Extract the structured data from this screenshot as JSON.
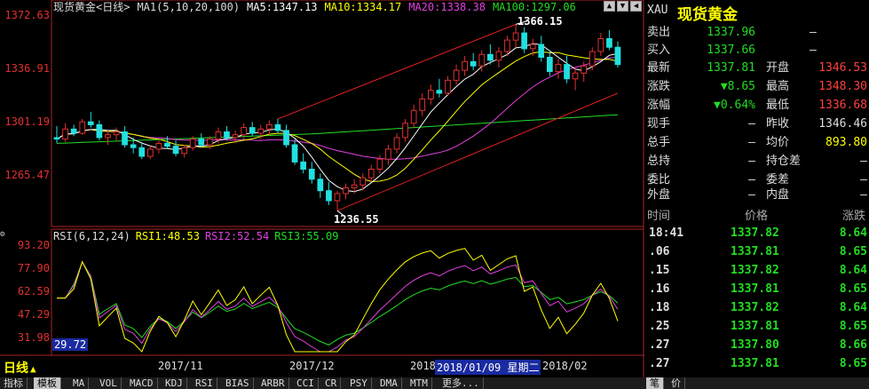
{
  "legend": {
    "symbol": "现货黄金<日线>",
    "ma_label": "MA1(5,10,20,100)",
    "ma5": "MA5:1347.13",
    "ma10": "MA10:1334.17",
    "ma20": "MA20:1338.38",
    "ma100": "MA100:1297.06"
  },
  "rsi_legend": {
    "label": "RSI(6,12,24)",
    "rsi1": "RSI1:48.53",
    "rsi2": "RSI2:52.54",
    "rsi3": "RSI3:55.09"
  },
  "price_axis": [
    "1372.63",
    "1336.91",
    "1301.19",
    "1265.47"
  ],
  "rsi_axis": [
    "93.20",
    "77.90",
    "62.59",
    "47.29",
    "31.98"
  ],
  "rsi_cursor_value": "29.72",
  "annotations": {
    "high": "1366.15",
    "low": "1236.55"
  },
  "x_axis": {
    "m1": "2017/11",
    "m2": "2017/12",
    "m3": "2018",
    "cursor_date": "2018/01/09 星期二",
    "m4": "2018/02"
  },
  "period_label": "日线",
  "period_arrow": "▲",
  "window_buttons": [
    "▲",
    "▼",
    "◀"
  ],
  "panel": {
    "code": "XAU",
    "name": "现货黄金",
    "sell_label": "卖出",
    "sell_value": "1337.96",
    "sell_extra": "–",
    "buy_label": "买入",
    "buy_value": "1337.66",
    "buy_extra": "–",
    "rows": [
      {
        "l1": "最新",
        "v1": "1337.81",
        "l2": "开盘",
        "v2": "1346.53"
      },
      {
        "l1": "涨跌",
        "v1": "▼8.65",
        "l2": "最高",
        "v2": "1348.30"
      },
      {
        "l1": "涨幅",
        "v1": "▼0.64%",
        "l2": "最低",
        "v2": "1336.68"
      },
      {
        "l1": "现手",
        "v1": "–",
        "l2": "昨收",
        "v2": "1346.46"
      },
      {
        "l1": "总手",
        "v1": "–",
        "l2": "均价",
        "v2": "893.80"
      },
      {
        "l1": "总持",
        "v1": "–",
        "l2": "持仓差",
        "v2": "–"
      },
      {
        "l1": "委比",
        "v1": "–",
        "l2": "委差",
        "v2": "–"
      },
      {
        "l1": "外盘",
        "v1": "–",
        "l2": "内盘",
        "v2": "–"
      }
    ],
    "tick_headers": {
      "time": "时间",
      "price": "价格",
      "change": "涨跌"
    },
    "ticks": [
      {
        "t": "18:41",
        "p": "1337.82",
        "c": "8.64"
      },
      {
        "t": ".06",
        "p": "1337.81",
        "c": "8.65"
      },
      {
        "t": ".15",
        "p": "1337.82",
        "c": "8.64"
      },
      {
        "t": ".16",
        "p": "1337.81",
        "c": "8.65"
      },
      {
        "t": ".18",
        "p": "1337.82",
        "c": "8.64"
      },
      {
        "t": ".25",
        "p": "1337.81",
        "c": "8.65"
      },
      {
        "t": ".27",
        "p": "1337.80",
        "c": "8.66"
      },
      {
        "t": ".27",
        "p": "1337.81",
        "c": "8.65"
      }
    ],
    "footer_tabs": [
      "笔",
      "价"
    ]
  },
  "bottom_tabs": [
    "指标",
    "模板",
    "MA",
    "VOL",
    "MACD",
    "KDJ",
    "RSI",
    "BIAS",
    "ARBR",
    "CCI",
    "CR",
    "PSY",
    "DMA",
    "MTM",
    "更多..."
  ],
  "colors": {
    "up": "#e03030",
    "down": "#22e0e0",
    "ma5": "#ffffff",
    "ma10": "#ffff00",
    "ma20": "#e040e0",
    "ma100": "#22dd22",
    "green_val": "#22dd22",
    "red_val": "#ff4040"
  },
  "chart_data": {
    "type": "candlestick",
    "y_range_price": [
      1230,
      1378
    ],
    "y_range_rsi": [
      25,
      98
    ],
    "candles": [
      [
        1287,
        1295,
        1283,
        1286
      ],
      [
        1286,
        1297,
        1284,
        1293
      ],
      [
        1293,
        1296,
        1288,
        1290
      ],
      [
        1290,
        1300,
        1289,
        1298
      ],
      [
        1298,
        1305,
        1294,
        1296
      ],
      [
        1296,
        1299,
        1285,
        1287
      ],
      [
        1287,
        1292,
        1282,
        1289
      ],
      [
        1289,
        1294,
        1285,
        1291
      ],
      [
        1291,
        1295,
        1280,
        1282
      ],
      [
        1282,
        1287,
        1276,
        1280
      ],
      [
        1280,
        1284,
        1272,
        1274
      ],
      [
        1274,
        1281,
        1272,
        1279
      ],
      [
        1279,
        1285,
        1276,
        1283
      ],
      [
        1283,
        1288,
        1279,
        1281
      ],
      [
        1281,
        1285,
        1274,
        1276
      ],
      [
        1276,
        1282,
        1273,
        1280
      ],
      [
        1280,
        1288,
        1278,
        1286
      ],
      [
        1286,
        1290,
        1280,
        1282
      ],
      [
        1282,
        1288,
        1279,
        1286
      ],
      [
        1286,
        1294,
        1283,
        1291
      ],
      [
        1291,
        1295,
        1285,
        1287
      ],
      [
        1287,
        1292,
        1283,
        1289
      ],
      [
        1289,
        1297,
        1286,
        1294
      ],
      [
        1294,
        1298,
        1288,
        1290
      ],
      [
        1290,
        1296,
        1286,
        1293
      ],
      [
        1293,
        1299,
        1289,
        1296
      ],
      [
        1296,
        1300,
        1290,
        1292
      ],
      [
        1292,
        1296,
        1280,
        1282
      ],
      [
        1282,
        1286,
        1268,
        1270
      ],
      [
        1270,
        1276,
        1262,
        1265
      ],
      [
        1265,
        1270,
        1255,
        1258
      ],
      [
        1258,
        1262,
        1245,
        1250
      ],
      [
        1250,
        1256,
        1240,
        1243
      ],
      [
        1243,
        1250,
        1236,
        1248
      ],
      [
        1248,
        1255,
        1244,
        1252
      ],
      [
        1252,
        1258,
        1248,
        1254
      ],
      [
        1254,
        1262,
        1250,
        1259
      ],
      [
        1259,
        1268,
        1256,
        1265
      ],
      [
        1265,
        1275,
        1262,
        1272
      ],
      [
        1272,
        1282,
        1268,
        1279
      ],
      [
        1279,
        1290,
        1276,
        1287
      ],
      [
        1287,
        1300,
        1284,
        1297
      ],
      [
        1297,
        1310,
        1294,
        1306
      ],
      [
        1306,
        1318,
        1302,
        1314
      ],
      [
        1314,
        1324,
        1310,
        1320
      ],
      [
        1320,
        1328,
        1315,
        1318
      ],
      [
        1318,
        1330,
        1316,
        1327
      ],
      [
        1327,
        1338,
        1324,
        1334
      ],
      [
        1334,
        1344,
        1330,
        1340
      ],
      [
        1340,
        1346,
        1334,
        1337
      ],
      [
        1337,
        1348,
        1333,
        1345
      ],
      [
        1345,
        1352,
        1338,
        1341
      ],
      [
        1341,
        1350,
        1336,
        1347
      ],
      [
        1347,
        1358,
        1344,
        1355
      ],
      [
        1355,
        1366,
        1350,
        1360
      ],
      [
        1360,
        1364,
        1346,
        1349
      ],
      [
        1349,
        1356,
        1344,
        1352
      ],
      [
        1352,
        1358,
        1340,
        1343
      ],
      [
        1343,
        1348,
        1330,
        1333
      ],
      [
        1333,
        1342,
        1328,
        1338
      ],
      [
        1338,
        1344,
        1325,
        1328
      ],
      [
        1328,
        1336,
        1320,
        1332
      ],
      [
        1332,
        1340,
        1326,
        1337
      ],
      [
        1337,
        1350,
        1334,
        1347
      ],
      [
        1347,
        1360,
        1344,
        1356
      ],
      [
        1356,
        1362,
        1348,
        1350
      ],
      [
        1350,
        1354,
        1336,
        1338
      ]
    ]
  }
}
